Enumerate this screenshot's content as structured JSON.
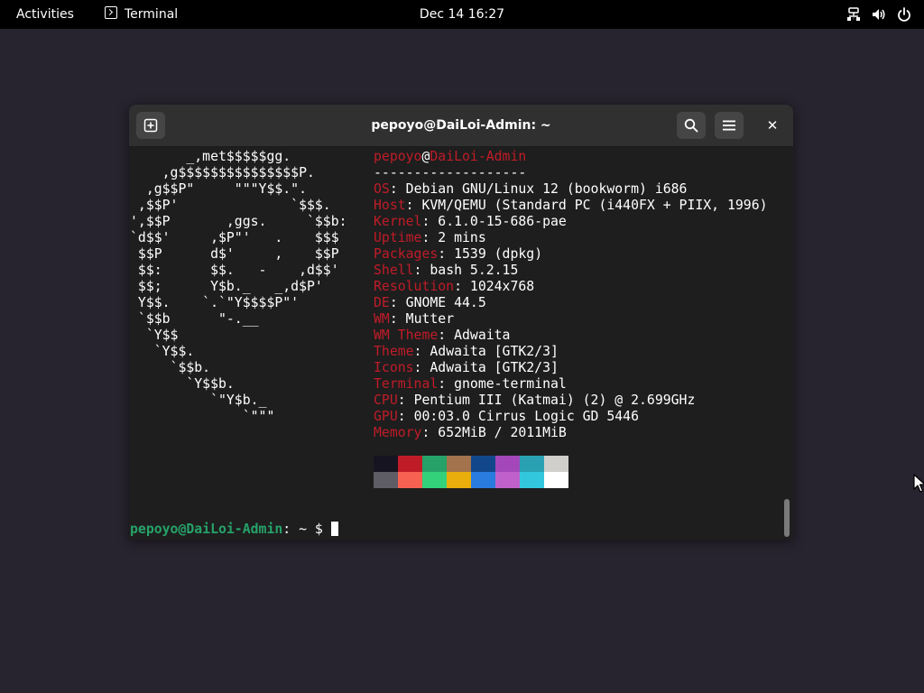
{
  "topbar": {
    "activities": "Activities",
    "app_name": "Terminal",
    "clock": "Dec 14  16:27",
    "tray_icons": [
      "network-icon",
      "volume-icon",
      "power-icon"
    ]
  },
  "window": {
    "title": "pepoyo@DaiLoi-Admin: ~",
    "buttons": [
      "new-tab-icon",
      "search-icon",
      "hamburger-menu-icon",
      "close-icon"
    ],
    "close_glyph": "✕"
  },
  "neofetch": {
    "user": "pepoyo",
    "at": "@",
    "host": "DaiLoi-Admin",
    "separator": "-------------------",
    "info": [
      {
        "label": "OS",
        "value": "Debian GNU/Linux 12 (bookworm) i686"
      },
      {
        "label": "Host",
        "value": "KVM/QEMU (Standard PC (i440FX + PIIX, 1996)"
      },
      {
        "label": "Kernel",
        "value": "6.1.0-15-686-pae"
      },
      {
        "label": "Uptime",
        "value": "2 mins"
      },
      {
        "label": "Packages",
        "value": "1539 (dpkg)"
      },
      {
        "label": "Shell",
        "value": "bash 5.2.15"
      },
      {
        "label": "Resolution",
        "value": "1024x768"
      },
      {
        "label": "DE",
        "value": "GNOME 44.5"
      },
      {
        "label": "WM",
        "value": "Mutter"
      },
      {
        "label": "WM Theme",
        "value": "Adwaita"
      },
      {
        "label": "Theme",
        "value": "Adwaita [GTK2/3]"
      },
      {
        "label": "Icons",
        "value": "Adwaita [GTK2/3]"
      },
      {
        "label": "Terminal",
        "value": "gnome-terminal"
      },
      {
        "label": "CPU",
        "value": "Pentium III (Katmai) (2) @ 2.699GHz"
      },
      {
        "label": "GPU",
        "value": "00:03.0 Cirrus Logic GD 5446"
      },
      {
        "label": "Memory",
        "value": "652MiB / 2011MiB"
      }
    ],
    "palette": [
      "#171421",
      "#c01c28",
      "#26a269",
      "#a2734c",
      "#12488b",
      "#a347ba",
      "#2aa1b3",
      "#d0cfcc",
      "#5e5c64",
      "#f66151",
      "#33d17a",
      "#e9ad0c",
      "#2a7bde",
      "#c061cb",
      "#33c7de",
      "#ffffff"
    ],
    "logo_lines": [
      "       _,met$$$$$gg.",
      "    ,g$$$$$$$$$$$$$$$P.",
      "  ,g$$P\"     \"\"\"Y$$.\".",
      " ,$$P'              `$$$.",
      "',$$P       ,ggs.     `$$b:",
      "`d$$'     ,$P\"'   .    $$$",
      " $$P      d$'     ,    $$P",
      " $$:      $$.   -    ,d$$'",
      " $$;      Y$b._   _,d$P'",
      " Y$$.    `.`\"Y$$$$P\"'",
      " `$$b      \"-.__",
      "  `Y$$",
      "   `Y$$.",
      "     `$$b.",
      "       `Y$$b.",
      "          `\"Y$b._",
      "              `\"\"\""
    ]
  },
  "prompt": {
    "user_host": "pepoyo@DaiLoi-Admin",
    "colon": ":",
    "path": " ",
    "symbol": "~ $ "
  }
}
